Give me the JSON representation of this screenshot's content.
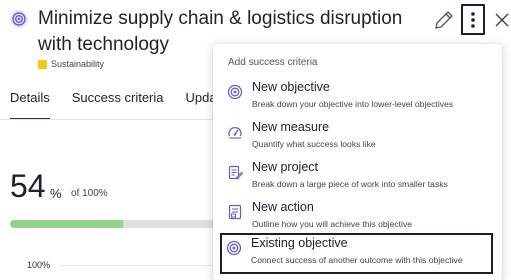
{
  "header": {
    "title": "Minimize supply chain & logistics disruption with technology",
    "tag_label": "Sustainability",
    "tag_color": "#f2c811"
  },
  "tabs": [
    {
      "label": "Details",
      "active": true
    },
    {
      "label": "Success criteria",
      "active": false
    },
    {
      "label": "Updat",
      "active": false
    }
  ],
  "progress": {
    "value": "54",
    "percent_sign": "%",
    "of_label": "of 100%",
    "fraction": 0.54,
    "axis_label": "100%"
  },
  "menu": {
    "header": "Add success criteria",
    "items": [
      {
        "icon": "objective-target-icon",
        "title": "New objective",
        "subtitle": "Break down your objective into lower-level objectives"
      },
      {
        "icon": "measure-gauge-icon",
        "title": "New measure",
        "subtitle": "Quantify what success looks like"
      },
      {
        "icon": "project-clipboard-icon",
        "title": "New project",
        "subtitle": "Break down a large piece of work into smaller tasks"
      },
      {
        "icon": "action-checklist-icon",
        "title": "New action",
        "subtitle": "Outline how you will achieve this objective"
      },
      {
        "icon": "existing-objective-icon",
        "title": "Existing objective",
        "subtitle": "Connect success of another outcome with this objective"
      }
    ]
  },
  "colors": {
    "accent": "#6b5cc7",
    "progress_fill": "#92d389",
    "highlight_border": "#1c1c3a"
  }
}
